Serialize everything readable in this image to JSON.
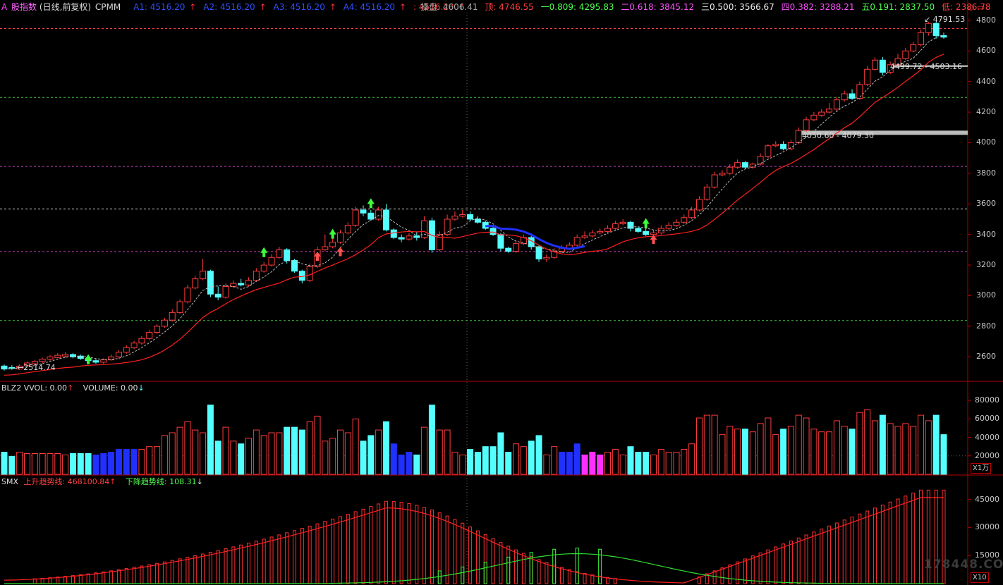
{
  "header": {
    "prefix": "A",
    "title": "股指数",
    "period": "(日线,前复权)",
    "indicator": "CPMM",
    "a1": "A1: 4516.20",
    "a2": "A2: 4516.20",
    "a3": "A3: 4516.20",
    "a4": "A4: 4516.20",
    "a5": ": 4516.20",
    "pan": "操盘: 4606.41",
    "top": "顶: 4746.55",
    "f1": "一0.809: 4295.83",
    "f2": "二0.618: 3845.12",
    "f3": "三0.500: 3566.67",
    "f4": "四0.382: 3288.21",
    "f5": "五0.191: 2837.50",
    "low": "低: 2386.78"
  },
  "price_axis": [
    "4800",
    "4600",
    "4400",
    "4200",
    "4000",
    "3800",
    "3600",
    "3400",
    "3200",
    "3000",
    "2800",
    "2600"
  ],
  "annotations": {
    "low_label": "2514.74",
    "high_label": "4791.53",
    "zone1": "4499.72 - 4503.16",
    "zone2": "4050.60 - 4079.30"
  },
  "volume_panel": {
    "label": "BLZ2  VVOL: 0.00",
    "volume_label": "VOLUME: 0.00",
    "axis": [
      "80000",
      "60000",
      "40000",
      "20000"
    ],
    "unit": "X1万"
  },
  "smx_panel": {
    "label": "SMX",
    "up": "上升趋势线: 468100.84",
    "down": "下降趋势线: 108.31",
    "axis": [
      "45000",
      "30000",
      "15000"
    ],
    "unit": "X10"
  },
  "watermark": "178448.COM",
  "colors": {
    "up": "#ff3c3c",
    "down": "#54ffff",
    "bg": "#000000",
    "fib_purple": "#c040c0",
    "fib_green": "#40c040",
    "fib_white": "#e0e0e0"
  },
  "chart_data": {
    "type": "candlestick",
    "price_range": [
      2440,
      4850
    ],
    "candles": [
      [
        2540,
        2520,
        2550,
        2510
      ],
      [
        2530,
        2525,
        2545,
        2515
      ],
      [
        2520,
        2540,
        2550,
        2515
      ],
      [
        2545,
        2560,
        2570,
        2535
      ],
      [
        2555,
        2570,
        2580,
        2545
      ],
      [
        2570,
        2585,
        2595,
        2560
      ],
      [
        2585,
        2600,
        2610,
        2575
      ],
      [
        2595,
        2610,
        2625,
        2590
      ],
      [
        2605,
        2615,
        2630,
        2595
      ],
      [
        2615,
        2600,
        2625,
        2590
      ],
      [
        2605,
        2590,
        2615,
        2580
      ],
      [
        2590,
        2575,
        2600,
        2565
      ],
      [
        2575,
        2565,
        2585,
        2555
      ],
      [
        2565,
        2580,
        2590,
        2555
      ],
      [
        2580,
        2600,
        2615,
        2575
      ],
      [
        2600,
        2630,
        2645,
        2595
      ],
      [
        2630,
        2660,
        2675,
        2620
      ],
      [
        2660,
        2690,
        2705,
        2650
      ],
      [
        2690,
        2720,
        2735,
        2680
      ],
      [
        2720,
        2760,
        2775,
        2710
      ],
      [
        2760,
        2800,
        2815,
        2750
      ],
      [
        2800,
        2840,
        2855,
        2790
      ],
      [
        2840,
        2890,
        2910,
        2830
      ],
      [
        2890,
        2960,
        2975,
        2880
      ],
      [
        2960,
        3050,
        3070,
        2950
      ],
      [
        3050,
        3110,
        3130,
        3040
      ],
      [
        3110,
        3160,
        3240,
        3100
      ],
      [
        3160,
        3010,
        3170,
        2990
      ],
      [
        3010,
        2990,
        3060,
        2970
      ],
      [
        2990,
        3060,
        3080,
        2980
      ],
      [
        3060,
        3080,
        3100,
        3050
      ],
      [
        3080,
        3070,
        3110,
        3060
      ],
      [
        3070,
        3100,
        3120,
        3060
      ],
      [
        3100,
        3160,
        3180,
        3090
      ],
      [
        3160,
        3200,
        3220,
        3150
      ],
      [
        3200,
        3250,
        3270,
        3190
      ],
      [
        3250,
        3300,
        3320,
        3240
      ],
      [
        3300,
        3230,
        3310,
        3210
      ],
      [
        3230,
        3160,
        3240,
        3150
      ],
      [
        3160,
        3100,
        3170,
        3080
      ],
      [
        3100,
        3190,
        3210,
        3090
      ],
      [
        3190,
        3300,
        3320,
        3180
      ],
      [
        3300,
        3320,
        3400,
        3290
      ],
      [
        3320,
        3350,
        3380,
        3310
      ],
      [
        3350,
        3410,
        3430,
        3340
      ],
      [
        3410,
        3460,
        3480,
        3400
      ],
      [
        3460,
        3560,
        3580,
        3450
      ],
      [
        3560,
        3540,
        3590,
        3520
      ],
      [
        3540,
        3500,
        3560,
        3490
      ],
      [
        3500,
        3560,
        3580,
        3490
      ],
      [
        3560,
        3430,
        3600,
        3420
      ],
      [
        3430,
        3380,
        3440,
        3370
      ],
      [
        3380,
        3370,
        3400,
        3350
      ],
      [
        3370,
        3390,
        3410,
        3360
      ],
      [
        3390,
        3380,
        3420,
        3360
      ],
      [
        3380,
        3490,
        3520,
        3370
      ],
      [
        3490,
        3300,
        3510,
        3280
      ],
      [
        3300,
        3400,
        3420,
        3290
      ],
      [
        3400,
        3500,
        3530,
        3390
      ],
      [
        3500,
        3520,
        3550,
        3490
      ],
      [
        3520,
        3530,
        3560,
        3510
      ],
      [
        3530,
        3500,
        3550,
        3490
      ],
      [
        3500,
        3480,
        3520,
        3470
      ],
      [
        3480,
        3440,
        3490,
        3430
      ],
      [
        3440,
        3400,
        3450,
        3390
      ],
      [
        3400,
        3310,
        3410,
        3290
      ],
      [
        3310,
        3290,
        3320,
        3280
      ],
      [
        3290,
        3340,
        3360,
        3280
      ],
      [
        3340,
        3380,
        3400,
        3330
      ],
      [
        3380,
        3320,
        3390,
        3300
      ],
      [
        3320,
        3240,
        3330,
        3220
      ],
      [
        3240,
        3250,
        3270,
        3220
      ],
      [
        3250,
        3290,
        3310,
        3240
      ],
      [
        3290,
        3310,
        3330,
        3280
      ],
      [
        3310,
        3330,
        3350,
        3300
      ],
      [
        3330,
        3380,
        3400,
        3320
      ],
      [
        3380,
        3390,
        3420,
        3370
      ],
      [
        3390,
        3410,
        3430,
        3380
      ],
      [
        3410,
        3420,
        3440,
        3400
      ],
      [
        3420,
        3440,
        3460,
        3410
      ],
      [
        3440,
        3470,
        3490,
        3430
      ],
      [
        3470,
        3480,
        3500,
        3460
      ],
      [
        3480,
        3440,
        3490,
        3420
      ],
      [
        3440,
        3420,
        3450,
        3410
      ],
      [
        3420,
        3400,
        3440,
        3390
      ],
      [
        3400,
        3410,
        3430,
        3390
      ],
      [
        3410,
        3440,
        3460,
        3400
      ],
      [
        3440,
        3460,
        3480,
        3430
      ],
      [
        3460,
        3480,
        3500,
        3450
      ],
      [
        3480,
        3510,
        3530,
        3470
      ],
      [
        3510,
        3560,
        3580,
        3500
      ],
      [
        3560,
        3630,
        3650,
        3550
      ],
      [
        3630,
        3710,
        3730,
        3620
      ],
      [
        3710,
        3790,
        3810,
        3700
      ],
      [
        3790,
        3800,
        3820,
        3780
      ],
      [
        3800,
        3840,
        3860,
        3790
      ],
      [
        3840,
        3870,
        3890,
        3830
      ],
      [
        3870,
        3840,
        3880,
        3830
      ],
      [
        3840,
        3860,
        3870,
        3830
      ],
      [
        3860,
        3910,
        3930,
        3850
      ],
      [
        3910,
        3980,
        3990,
        3900
      ],
      [
        3980,
        3990,
        4010,
        3970
      ],
      [
        3990,
        3960,
        4010,
        3950
      ],
      [
        3960,
        4000,
        4020,
        3950
      ],
      [
        4000,
        4080,
        4100,
        3990
      ],
      [
        4080,
        4150,
        4170,
        4070
      ],
      [
        4150,
        4180,
        4200,
        4140
      ],
      [
        4180,
        4200,
        4220,
        4170
      ],
      [
        4200,
        4220,
        4260,
        4190
      ],
      [
        4220,
        4280,
        4300,
        4210
      ],
      [
        4280,
        4320,
        4340,
        4270
      ],
      [
        4320,
        4290,
        4350,
        4280
      ],
      [
        4290,
        4380,
        4400,
        4280
      ],
      [
        4380,
        4480,
        4500,
        4370
      ],
      [
        4480,
        4540,
        4560,
        4470
      ],
      [
        4540,
        4460,
        4560,
        4440
      ],
      [
        4460,
        4510,
        4530,
        4450
      ],
      [
        4510,
        4550,
        4580,
        4500
      ],
      [
        4550,
        4600,
        4620,
        4540
      ],
      [
        4600,
        4640,
        4660,
        4590
      ],
      [
        4640,
        4720,
        4740,
        4630
      ],
      [
        4720,
        4780,
        4791,
        4700
      ],
      [
        4780,
        4700,
        4790,
        4680
      ],
      [
        4700,
        4690,
        4720,
        4680
      ]
    ],
    "volume": {
      "range": [
        0,
        90000
      ]
    },
    "smx": {
      "range": [
        0,
        52000
      ]
    }
  }
}
